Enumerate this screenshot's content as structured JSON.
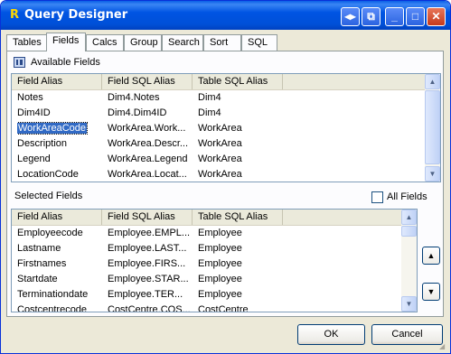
{
  "window": {
    "title": "Query Designer",
    "app_icon_glyph": "R"
  },
  "title_buttons": {
    "extra1": "◂▸",
    "extra2": "⧉",
    "minimize": "_",
    "maximize": "□",
    "close": "✕"
  },
  "tabs": [
    {
      "label": "Tables",
      "active": false
    },
    {
      "label": "Fields",
      "active": true
    },
    {
      "label": "Calcs",
      "active": false
    },
    {
      "label": "Group",
      "active": false
    },
    {
      "label": "Search",
      "active": false
    },
    {
      "label": "Sort",
      "active": false
    },
    {
      "label": "SQL",
      "active": false
    }
  ],
  "available": {
    "title": "Available Fields",
    "columns": [
      "Field Alias",
      "Field SQL Alias",
      "Table SQL Alias"
    ],
    "rows": [
      [
        "Notes",
        "Dim4.Notes",
        "Dim4"
      ],
      [
        "Dim4ID",
        "Dim4.Dim4ID",
        "Dim4"
      ],
      [
        "WorkAreaCode",
        "WorkArea.Work...",
        "WorkArea"
      ],
      [
        "Description",
        "WorkArea.Descr...",
        "WorkArea"
      ],
      [
        "Legend",
        "WorkArea.Legend",
        "WorkArea"
      ],
      [
        "LocationCode",
        "WorkArea.Locat...",
        "WorkArea"
      ]
    ],
    "selected_row": 2
  },
  "selected": {
    "title": "Selected Fields",
    "all_fields_label": "All Fields",
    "all_fields_checked": false,
    "columns": [
      "Field Alias",
      "Field SQL Alias",
      "Table SQL Alias"
    ],
    "rows": [
      [
        "Employeecode",
        "Employee.EMPL...",
        "Employee"
      ],
      [
        "Lastname",
        "Employee.LAST...",
        "Employee"
      ],
      [
        "Firstnames",
        "Employee.FIRS...",
        "Employee"
      ],
      [
        "Startdate",
        "Employee.STAR...",
        "Employee"
      ],
      [
        "Terminationdate",
        "Employee.TER...",
        "Employee"
      ],
      [
        "Costcentrecode",
        "CostCentre.COS...",
        "CostCentre"
      ]
    ]
  },
  "buttons": {
    "ok": "OK",
    "cancel": "Cancel",
    "move_up": "▲",
    "move_down": "▼"
  },
  "colors": {
    "title_bar": "#0054e3",
    "selection": "#316ac5",
    "dialog_bg": "#ece9d8"
  }
}
